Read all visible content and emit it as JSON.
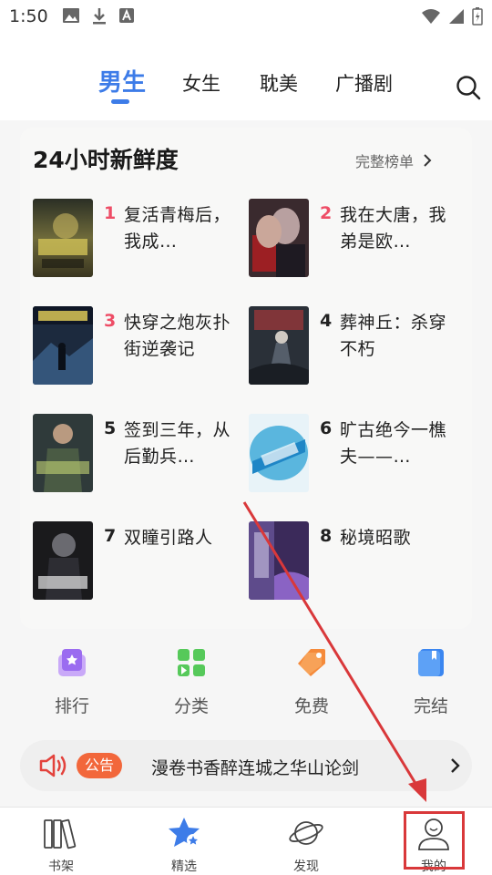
{
  "status_bar": {
    "time": "1:50"
  },
  "tabs": [
    {
      "label": "男生",
      "active": true
    },
    {
      "label": "女生"
    },
    {
      "label": "耽美"
    },
    {
      "label": "广播剧"
    }
  ],
  "ranking": {
    "title": "24小时新鲜度",
    "more_label": "完整榜单",
    "books": [
      {
        "rank": "1",
        "title": "复活青梅后，我成…",
        "hot": true
      },
      {
        "rank": "2",
        "title": "我在大唐，我弟是欧…",
        "hot": true
      },
      {
        "rank": "3",
        "title": "快穿之炮灰扑街逆袭记",
        "hot": true
      },
      {
        "rank": "4",
        "title": "葬神丘：杀穿不朽"
      },
      {
        "rank": "5",
        "title": "签到三年，从后勤兵…"
      },
      {
        "rank": "6",
        "title": "旷古绝今一樵夫——…"
      },
      {
        "rank": "7",
        "title": "双瞳引路人"
      },
      {
        "rank": "8",
        "title": "秘境昭歌"
      }
    ]
  },
  "shortcuts": [
    {
      "label": "排行",
      "icon": "ranking-icon",
      "color": "#a77af2"
    },
    {
      "label": "分类",
      "icon": "category-icon",
      "color": "#4fc95b"
    },
    {
      "label": "免费",
      "icon": "free-tag-icon",
      "color": "#f58a3a"
    },
    {
      "label": "完结",
      "icon": "completed-book-icon",
      "color": "#3b86f0"
    }
  ],
  "notice": {
    "badge": "公告",
    "text": "漫卷书香醉连城之华山论剑"
  },
  "bottom_nav": [
    {
      "label": "书架",
      "icon": "bookshelf-icon"
    },
    {
      "label": "精选",
      "icon": "star-icon",
      "active": true
    },
    {
      "label": "发现",
      "icon": "planet-icon"
    },
    {
      "label": "我的",
      "icon": "profile-icon"
    }
  ],
  "colors": {
    "accent": "#3d7ce8",
    "hot_rank": "#ee4d66",
    "notice_badge": "#f2673b",
    "annotation": "#d9383a"
  }
}
